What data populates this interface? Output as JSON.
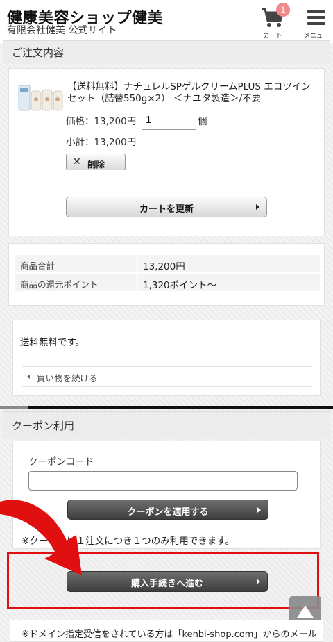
{
  "header": {
    "shop_name": "健康美容ショップ健美",
    "shop_subtitle": "有限会社健美 公式サイト",
    "cart_count": "1",
    "cart_label": "カート",
    "menu_label": "メニュー"
  },
  "order": {
    "section_title": "ご注文内容",
    "product_name": "【送料無料】ナチュレルSPゲルクリームPLUS エコツインセット（詰替550g×2） ＜ナユタ製造＞/不要",
    "price_label": "価格：13,200円",
    "quantity": "1",
    "quantity_unit": "個",
    "subtotal": "小計：13,200円",
    "delete_label": "削除",
    "update_cart_label": "カートを更新"
  },
  "totals": {
    "rows": [
      {
        "label": "商品合計",
        "value": "13,200円"
      },
      {
        "label": "商品の還元ポイント",
        "value": "1,320ポイント～"
      }
    ]
  },
  "shipping": {
    "note": "送料無料です。",
    "continue_label": "買い物を続ける"
  },
  "coupon": {
    "section_title": "クーポン利用",
    "code_label": "クーポンコード",
    "code_value": "",
    "apply_label": "クーポンを適用する",
    "note": "※クーポンは１注文につき１つのみ利用できます。"
  },
  "checkout": {
    "label": "購入手続きへ進む"
  },
  "footer": {
    "note": "※ドメイン指定受信をされている方は「kenbi-shop.com」からのメール"
  },
  "colors": {
    "highlight": "#e01010",
    "badge": "#f08a8a",
    "dark_button": "#4a4a4a"
  }
}
